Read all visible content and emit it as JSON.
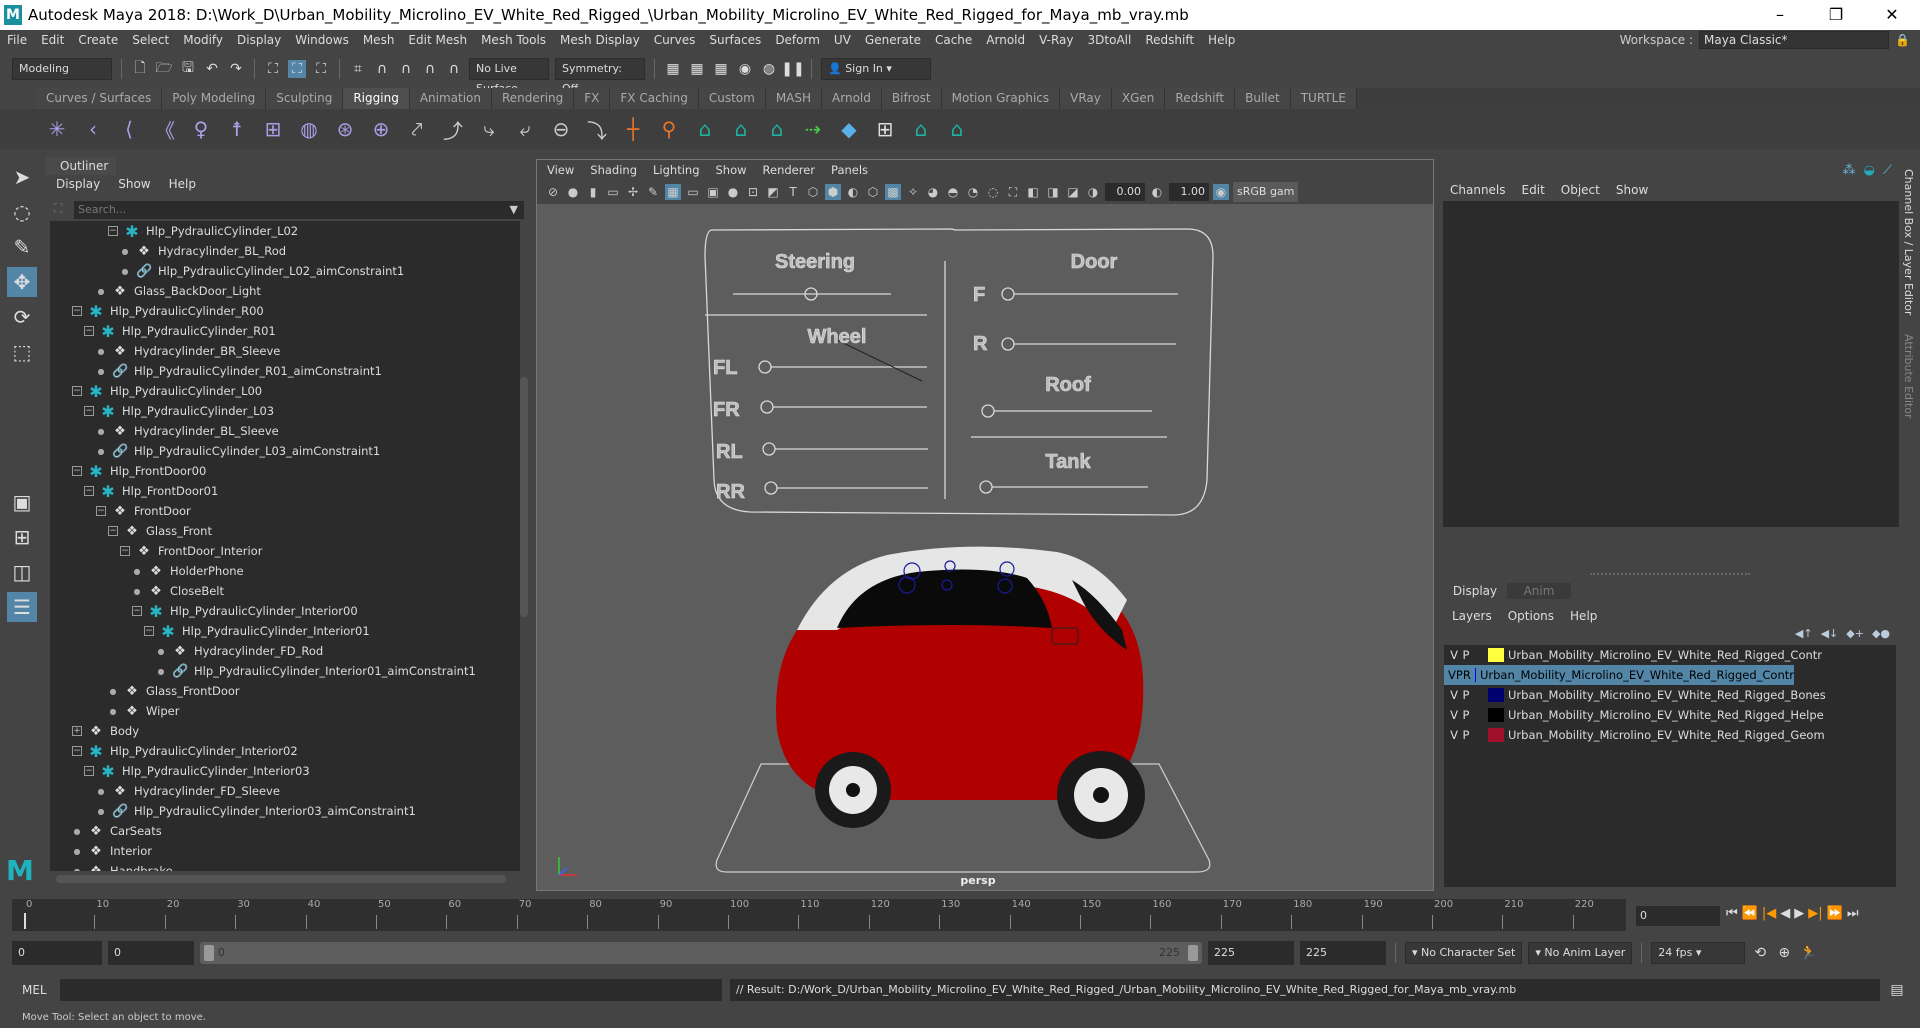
{
  "title": "Autodesk Maya 2018: D:\\Work_D\\Urban_Mobility_Microlino_EV_White_Red_Rigged_\\Urban_Mobility_Microlino_EV_White_Red_Rigged_for_Maya_mb_vray.mb",
  "window_buttons": [
    "–",
    "❐",
    "✕"
  ],
  "menu": [
    "File",
    "Edit",
    "Create",
    "Select",
    "Modify",
    "Display",
    "Windows",
    "Mesh",
    "Edit Mesh",
    "Mesh Tools",
    "Mesh Display",
    "Curves",
    "Surfaces",
    "Deform",
    "UV",
    "Generate",
    "Cache",
    "Arnold",
    "V-Ray",
    "3DtoAll",
    "Redshift",
    "Help"
  ],
  "workspace": {
    "label": "Workspace :",
    "value": "Maya Classic*"
  },
  "status": {
    "mode": "Modeling",
    "live_surface": "No Live Surface",
    "symmetry": "Symmetry: Off",
    "sign_in": "Sign In"
  },
  "shelf_tabs": [
    "Curves / Surfaces",
    "Poly Modeling",
    "Sculpting",
    "Rigging",
    "Animation",
    "Rendering",
    "FX",
    "FX Caching",
    "Custom",
    "MASH",
    "Arnold",
    "Bifrost",
    "Motion Graphics",
    "VRay",
    "XGen",
    "Redshift",
    "Bullet",
    "TURTLE"
  ],
  "active_shelf_tab": "Rigging",
  "shelf_icons": [
    "joint-tool",
    "ik-handle",
    "ik-spline",
    "skin-bind",
    "humanik",
    "quick-rig",
    "cluster",
    "lattice",
    "wrap",
    "soft-mod",
    "parent-constraint",
    "point-constraint",
    "orient-constraint",
    "scale-constraint",
    "aim-constraint",
    "pole-vector",
    "locator",
    "rivet",
    "deformer-a",
    "deformer-b",
    "deformer-c",
    "connect",
    "blend-shape",
    "grid",
    "deformer-d",
    "deformer-e"
  ],
  "outliner": {
    "title": "Outliner",
    "menu": [
      "Display",
      "Show",
      "Help"
    ],
    "search_placeholder": "Search...",
    "items": [
      {
        "name": "Hlp_PydraulicCylinder_L02",
        "level": 3,
        "icon": "joint",
        "exp": "minus"
      },
      {
        "name": "Hydracylinder_BL_Rod",
        "level": 4,
        "icon": "mesh",
        "exp": "none"
      },
      {
        "name": "Hlp_PydraulicCylinder_L02_aimConstraint1",
        "level": 4,
        "icon": "constraint",
        "exp": "none"
      },
      {
        "name": "Glass_BackDoor_Light",
        "level": 2,
        "icon": "mesh",
        "exp": "none"
      },
      {
        "name": "Hlp_PydraulicCylinder_R00",
        "level": 0,
        "icon": "joint",
        "exp": "minus"
      },
      {
        "name": "Hlp_PydraulicCylinder_R01",
        "level": 1,
        "icon": "joint",
        "exp": "minus"
      },
      {
        "name": "Hydracylinder_BR_Sleeve",
        "level": 2,
        "icon": "mesh",
        "exp": "none"
      },
      {
        "name": "Hlp_PydraulicCylinder_R01_aimConstraint1",
        "level": 2,
        "icon": "constraint",
        "exp": "none"
      },
      {
        "name": "Hlp_PydraulicCylinder_L00",
        "level": 0,
        "icon": "joint",
        "exp": "minus"
      },
      {
        "name": "Hlp_PydraulicCylinder_L03",
        "level": 1,
        "icon": "joint",
        "exp": "minus"
      },
      {
        "name": "Hydracylinder_BL_Sleeve",
        "level": 2,
        "icon": "mesh",
        "exp": "none"
      },
      {
        "name": "Hlp_PydraulicCylinder_L03_aimConstraint1",
        "level": 2,
        "icon": "constraint",
        "exp": "none"
      },
      {
        "name": "Hlp_FrontDoor00",
        "level": 0,
        "icon": "joint",
        "exp": "minus"
      },
      {
        "name": "Hlp_FrontDoor01",
        "level": 1,
        "icon": "joint",
        "exp": "minus"
      },
      {
        "name": "FrontDoor",
        "level": 2,
        "icon": "mesh",
        "exp": "minus"
      },
      {
        "name": "Glass_Front",
        "level": 3,
        "icon": "mesh",
        "exp": "minus"
      },
      {
        "name": "FrontDoor_Interior",
        "level": 4,
        "icon": "mesh",
        "exp": "minus"
      },
      {
        "name": "HolderPhone",
        "level": 5,
        "icon": "mesh",
        "exp": "none"
      },
      {
        "name": "CloseBelt",
        "level": 5,
        "icon": "mesh",
        "exp": "none"
      },
      {
        "name": "Hlp_PydraulicCylinder_Interior00",
        "level": 5,
        "icon": "joint",
        "exp": "minus"
      },
      {
        "name": "Hlp_PydraulicCylinder_Interior01",
        "level": 6,
        "icon": "joint",
        "exp": "minus"
      },
      {
        "name": "Hydracylinder_FD_Rod",
        "level": 7,
        "icon": "mesh",
        "exp": "none"
      },
      {
        "name": "Hlp_PydraulicCylinder_Interior01_aimConstraint1",
        "level": 7,
        "icon": "constraint",
        "exp": "none"
      },
      {
        "name": "Glass_FrontDoor",
        "level": 3,
        "icon": "mesh",
        "exp": "none"
      },
      {
        "name": "Wiper",
        "level": 3,
        "icon": "mesh",
        "exp": "none"
      },
      {
        "name": "Body",
        "level": 0,
        "icon": "mesh",
        "exp": "plus"
      },
      {
        "name": "Hlp_PydraulicCylinder_Interior02",
        "level": 0,
        "icon": "joint",
        "exp": "minus"
      },
      {
        "name": "Hlp_PydraulicCylinder_Interior03",
        "level": 1,
        "icon": "joint",
        "exp": "minus"
      },
      {
        "name": "Hydracylinder_FD_Sleeve",
        "level": 2,
        "icon": "mesh",
        "exp": "none"
      },
      {
        "name": "Hlp_PydraulicCylinder_Interior03_aimConstraint1",
        "level": 2,
        "icon": "constraint",
        "exp": "none"
      },
      {
        "name": "CarSeats",
        "level": 0,
        "icon": "mesh",
        "exp": "none"
      },
      {
        "name": "Interior",
        "level": 0,
        "icon": "mesh",
        "exp": "none"
      },
      {
        "name": "Handbrake",
        "level": 0,
        "icon": "mesh",
        "exp": "none"
      }
    ]
  },
  "viewport": {
    "menu": [
      "View",
      "Shading",
      "Lighting",
      "Show",
      "Renderer",
      "Panels"
    ],
    "exposure": "0.00",
    "gamma": "1.00",
    "color_space": "sRGB gam",
    "camera": "persp",
    "panel": {
      "steering": "Steering",
      "wheel": "Wheel",
      "door": "Door",
      "roof": "Roof",
      "tank": "Tank",
      "wheel_labels": [
        "FL",
        "FR",
        "RL",
        "RR"
      ],
      "door_labels": [
        "F",
        "R"
      ]
    }
  },
  "channel_box": {
    "menu": [
      "Channels",
      "Edit",
      "Object",
      "Show"
    ]
  },
  "layer_editor": {
    "tabs": [
      "Display",
      "Anim"
    ],
    "menu": [
      "Layers",
      "Options",
      "Help"
    ],
    "layers": [
      {
        "v": "V",
        "p": "P",
        "r": "",
        "color": "#ffff40",
        "name": "Urban_Mobility_Microlino_EV_White_Red_Rigged_Contr",
        "selected": false
      },
      {
        "v": "V",
        "p": "P",
        "r": "R",
        "color": "#0000ff",
        "name": "Urban_Mobility_Microlino_EV_White_Red_Rigged_Contr",
        "selected": true
      },
      {
        "v": "V",
        "p": "P",
        "r": "",
        "color": "#000070",
        "name": "Urban_Mobility_Microlino_EV_White_Red_Rigged_Bones",
        "selected": false
      },
      {
        "v": "V",
        "p": "P",
        "r": "",
        "color": "#000000",
        "name": "Urban_Mobility_Microlino_EV_White_Red_Rigged_Helpe",
        "selected": false
      },
      {
        "v": "V",
        "p": "P",
        "r": "",
        "color": "#a0102a",
        "name": "Urban_Mobility_Microlino_EV_White_Red_Rigged_Geom",
        "selected": false
      }
    ]
  },
  "side_tabs": [
    "Channel Box / Layer Editor",
    "Attribute Editor"
  ],
  "timeline": {
    "start": 0,
    "end": 225,
    "ticks": [
      0,
      10,
      20,
      30,
      40,
      50,
      60,
      70,
      80,
      90,
      100,
      110,
      120,
      130,
      140,
      150,
      160,
      170,
      180,
      190,
      200,
      210,
      220
    ],
    "current_frame": "0"
  },
  "range": {
    "start": "0",
    "playback_start": "0",
    "slider_start": "0",
    "slider_end": "225",
    "playback_end": "225",
    "end": "225",
    "character_set": "No Character Set",
    "anim_layer": "No Anim Layer",
    "fps": "24 fps"
  },
  "mel": {
    "label": "MEL",
    "result": "// Result: D:/Work_D/Urban_Mobility_Microlino_EV_White_Red_Rigged_/Urban_Mobility_Microlino_EV_White_Red_Rigged_for_Maya_mb_vray.mb"
  },
  "help_line": "Move Tool: Select an object to move."
}
